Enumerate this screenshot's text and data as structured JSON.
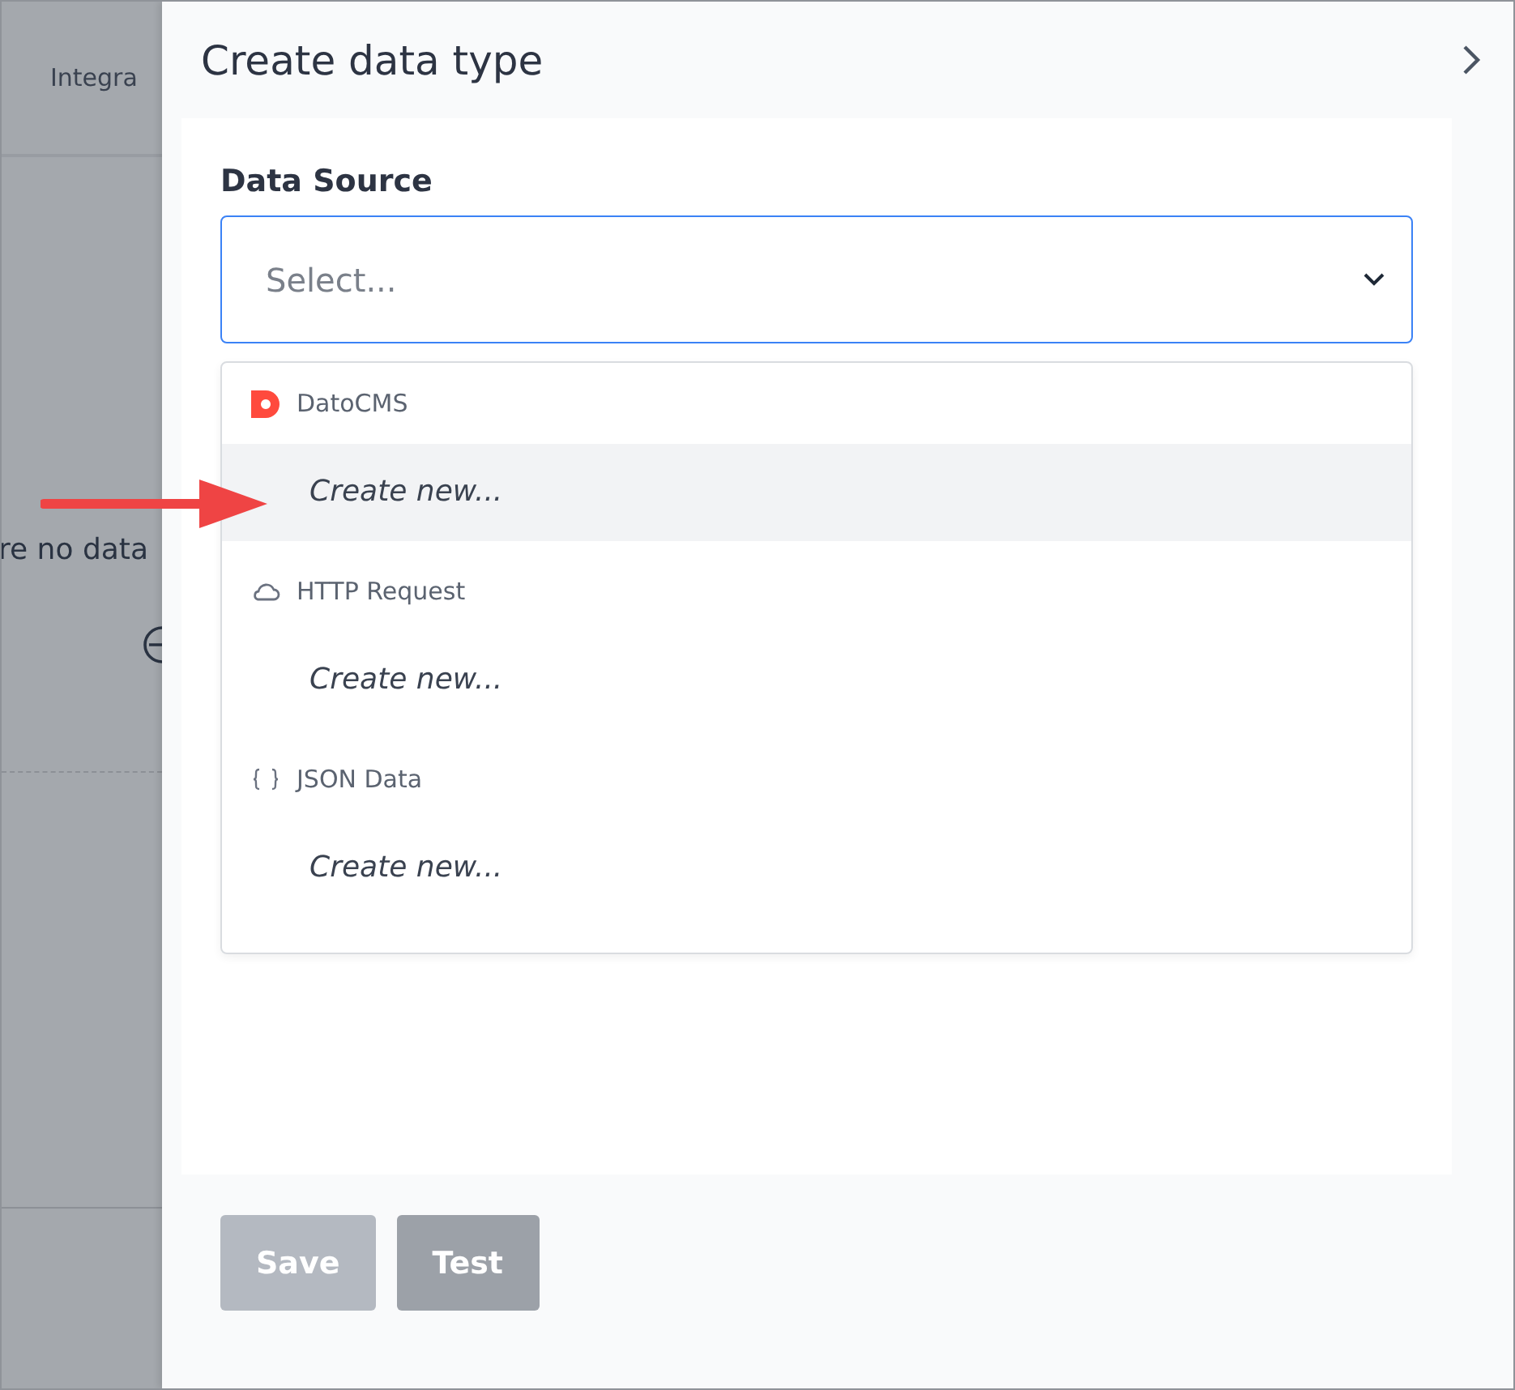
{
  "background": {
    "tab_label": "Integra",
    "empty_text": "re no data"
  },
  "drawer": {
    "title": "Create data type",
    "field_label": "Data Source",
    "select": {
      "placeholder": "Select..."
    },
    "groups": [
      {
        "kind": "datocms",
        "name": "DatoCMS",
        "options": [
          {
            "label": "Create new...",
            "selected": true
          }
        ]
      },
      {
        "kind": "http",
        "name": "HTTP Request",
        "options": [
          {
            "label": "Create new...",
            "selected": false
          }
        ]
      },
      {
        "kind": "json",
        "name": "JSON Data",
        "options": [
          {
            "label": "Create new...",
            "selected": false
          }
        ]
      }
    ],
    "buttons": [
      {
        "label": "Save",
        "disabled": true
      },
      {
        "label": "Test",
        "disabled": false
      }
    ]
  }
}
